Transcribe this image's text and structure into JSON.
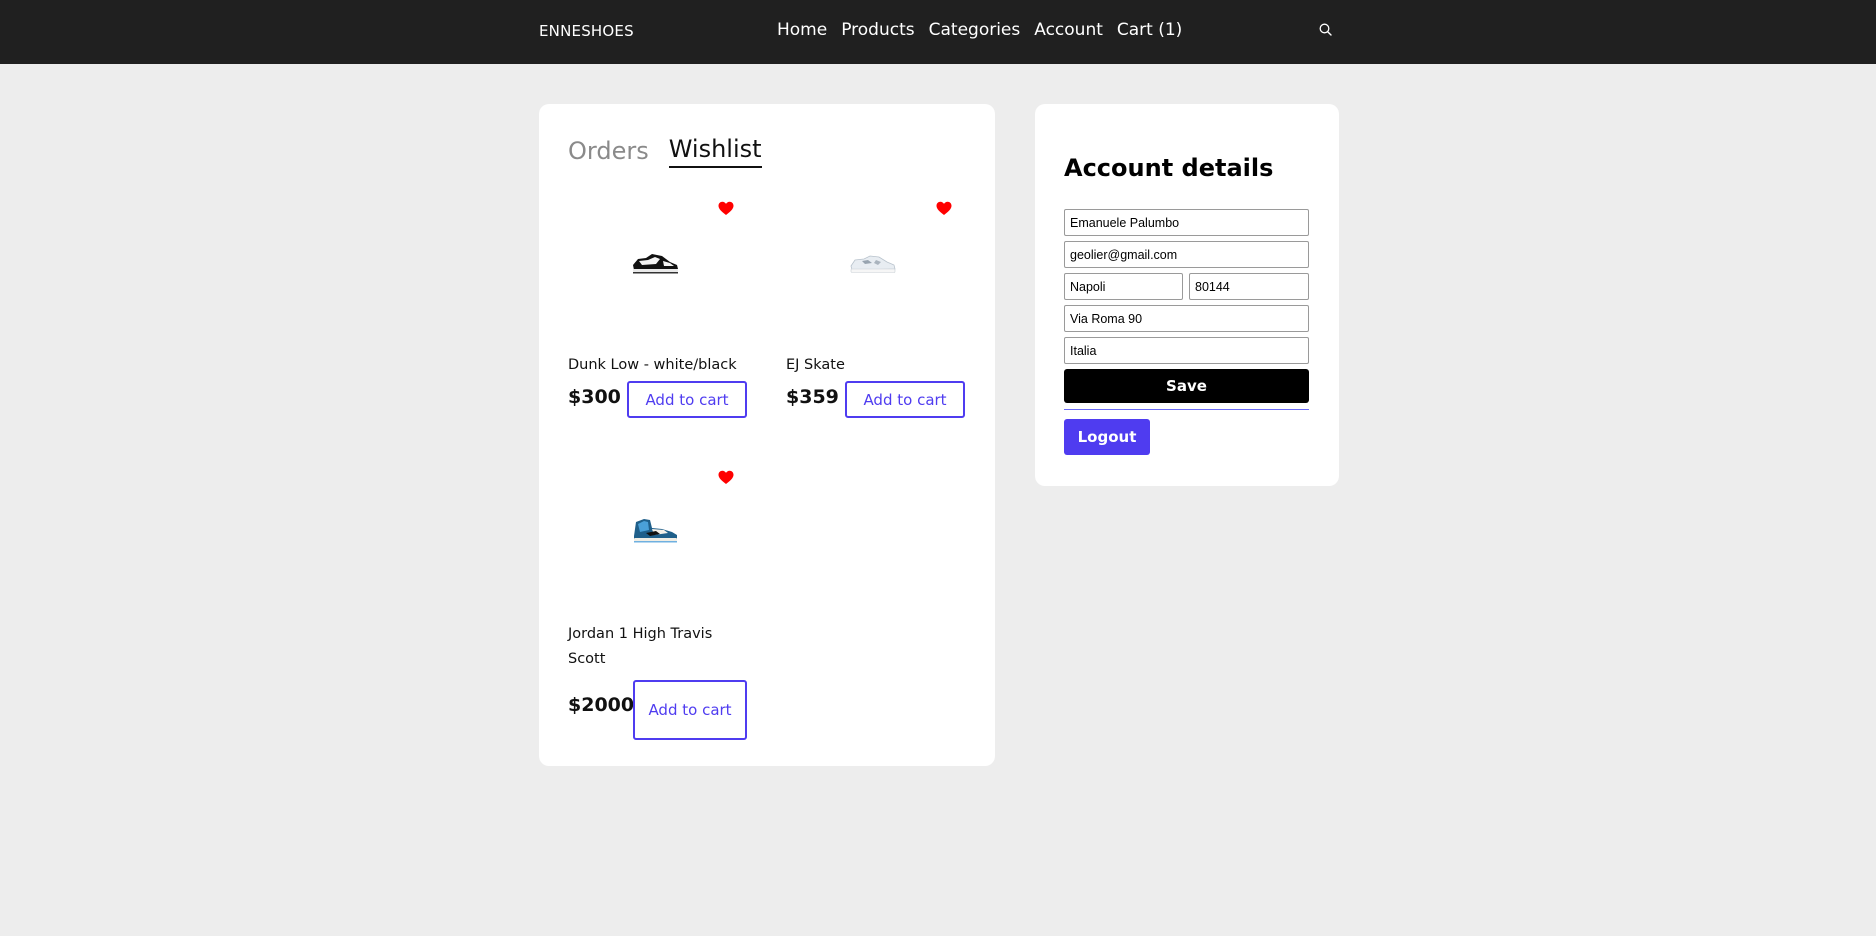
{
  "header": {
    "brand": "ENNESHOES",
    "nav": [
      "Home",
      "Products",
      "Categories",
      "Account",
      "Cart (1)"
    ],
    "search_icon": "search-icon"
  },
  "tabs": [
    "Orders",
    "Wishlist"
  ],
  "active_tab": "Wishlist",
  "wishlist": [
    {
      "name": "Dunk Low - white/black",
      "price": "$300",
      "button": "Add to cart",
      "favorited": true
    },
    {
      "name": "EJ Skate",
      "price": "$359",
      "button": "Add to cart",
      "favorited": true
    },
    {
      "name": "Jordan 1 High Travis Scott",
      "price": "$2000",
      "button": "Add to cart",
      "favorited": true
    }
  ],
  "account": {
    "title": "Account details",
    "fields": {
      "name": "Emanuele Palumbo",
      "email": "geolier@gmail.com",
      "city": "Napoli",
      "zip": "80144",
      "address": "Via Roma 90",
      "country": "Italia"
    },
    "save_label": "Save",
    "logout_label": "Logout"
  },
  "colors": {
    "topbar": "#202020",
    "background": "#ededed",
    "accent": "#4f3cf0",
    "heart": "#ff0000"
  }
}
